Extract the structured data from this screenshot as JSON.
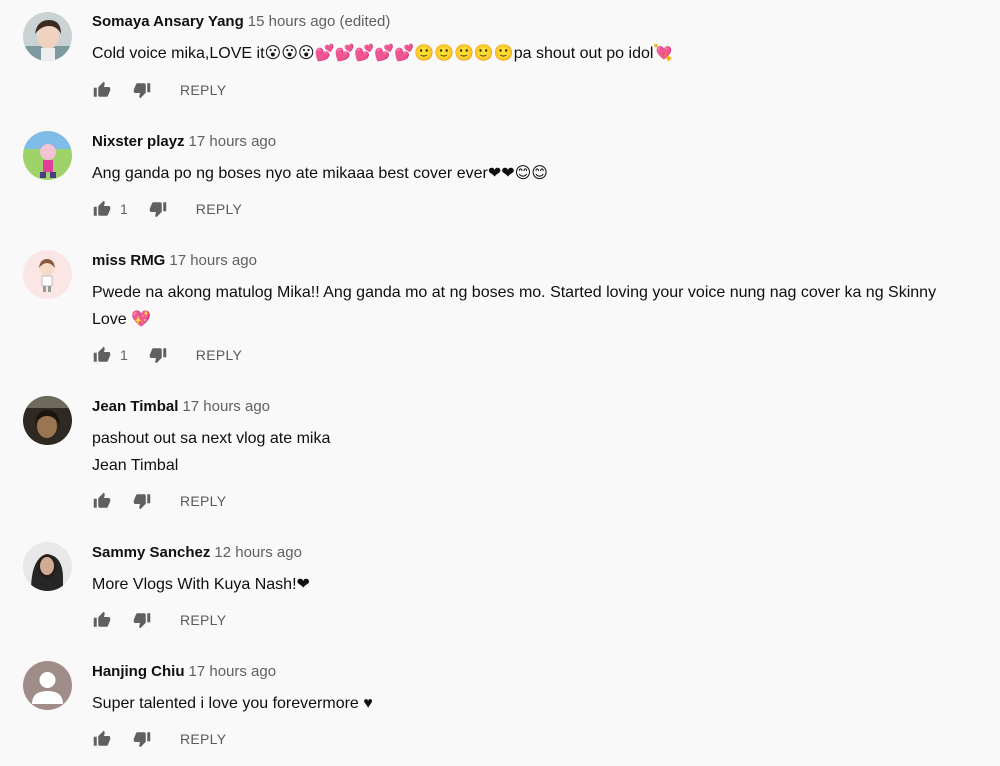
{
  "comments": [
    {
      "author": "Somaya Ansary Yang",
      "time": "15 hours ago (edited)",
      "text_lines": [
        "Cold voice mika,LOVE it😮😮😮💕💕💕💕💕🙂🙂🙂🙂🙂pa shout out po idol💘"
      ],
      "likes": "",
      "reply_label": "REPLY",
      "avatar": "photo-avatar"
    },
    {
      "author": "Nixster playz",
      "time": "17 hours ago",
      "text_lines": [
        "Ang ganda po ng boses nyo ate mikaaa best cover ever❤❤😊😊"
      ],
      "likes": "1",
      "reply_label": "REPLY",
      "avatar": "game-character-avatar"
    },
    {
      "author": "miss RMG",
      "time": "17 hours ago",
      "text_lines": [
        "Pwede na akong matulog Mika!! Ang ganda mo at ng boses mo. Started loving your voice nung nag cover ka ng Skinny",
        "Love 💖"
      ],
      "likes": "1",
      "reply_label": "REPLY",
      "avatar": "cartoon-girl-avatar"
    },
    {
      "author": "Jean Timbal",
      "time": "17 hours ago",
      "text_lines": [
        "pashout out sa next vlog ate mika",
        "Jean Timbal"
      ],
      "likes": "",
      "reply_label": "REPLY",
      "avatar": "photo-avatar"
    },
    {
      "author": "Sammy Sanchez",
      "time": "12 hours ago",
      "text_lines": [
        "More Vlogs With Kuya Nash!❤"
      ],
      "likes": "",
      "reply_label": "REPLY",
      "avatar": "photo-avatar"
    },
    {
      "author": "Hanjing Chiu",
      "time": "17 hours ago",
      "text_lines": [
        "Super talented i love you forevermore ♥"
      ],
      "likes": "",
      "reply_label": "REPLY",
      "avatar": "default-avatar"
    }
  ],
  "colors": {
    "background": "#f9f9f9",
    "author": "#111111",
    "timestamp": "#606060",
    "icon": "#606060"
  }
}
